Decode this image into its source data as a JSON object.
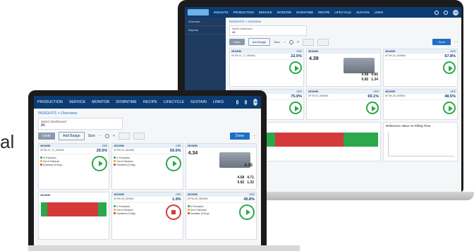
{
  "stray_text": "al",
  "back": {
    "nav": [
      "INSIGHTS",
      "PRODUCTION",
      "SERVICE",
      "MONITOR",
      "DOWNTIME",
      "RECIPE",
      "LIFECYCLE",
      "SUSTAIN",
      "LINKS"
    ],
    "user_initials": "UM",
    "sidebar": [
      "Overview",
      "Reports"
    ],
    "breadcrumb": "INSIGHTS > Overview",
    "dashboard": {
      "label": "Select Dashboard",
      "value": "All"
    },
    "toolbar": {
      "undo": "Undo",
      "add": "Add Badge",
      "size": "Size:",
      "done": "Done"
    },
    "cards": [
      {
        "id": "#E10050",
        "title": "AP76K-57_T1_050MM1",
        "oee_label": "OEE",
        "oee": "22.5%",
        "status": "run"
      },
      {
        "id": "#E10050",
        "value": "4.39",
        "status": "machine",
        "stats": [
          "4.68",
          "4.85",
          "0.82",
          "1.34"
        ]
      },
      {
        "id": "#E10050",
        "title": "AP76K-60_050MM8",
        "oee_label": "OEE",
        "oee": "67.8%",
        "status": "run"
      },
      {
        "id": "#E10050",
        "title": "AP76K-56_050MM1",
        "oee_label": "OEE",
        "oee": "75.9%",
        "status": "run"
      },
      {
        "id": "#E10050",
        "title": "AP76K-57_050MM1",
        "oee_label": "OEE",
        "oee": "69.1%",
        "status": "run"
      },
      {
        "id": "#E10050",
        "title": "AP76K-58_050MM1",
        "oee_label": "OEE",
        "oee": "48.5%",
        "status": "run"
      }
    ],
    "chart_title": "Reference Value As Filling Time"
  },
  "front": {
    "nav": [
      "PRODUCTION",
      "SERVICE",
      "MONITOR",
      "DOWNTIME",
      "RECIPE",
      "LIFECYCLE",
      "SUSTAIN",
      "LINKS"
    ],
    "user_initials": "UM",
    "breadcrumb": "INSIGHTS > Overview",
    "dashboard": {
      "label": "Select Dashboard",
      "value": "All"
    },
    "toolbar": {
      "undo": "Undo",
      "add": "Add Badge",
      "size": "Size:",
      "done": "Done"
    },
    "legend": [
      "In Production",
      "Out of Tolerance",
      "Downtime (S-Stop)"
    ],
    "cards": [
      {
        "id": "#E10050",
        "title": "AP76K-57_T1_050MM1",
        "oee_label": "OEE",
        "oee": "29.5%",
        "status": "run"
      },
      {
        "id": "#E10050",
        "title": "AP76K-60_050MM8",
        "oee_label": "OEE",
        "oee": "59.6%",
        "status": "run"
      },
      {
        "id": "#E10050",
        "value": "4.34",
        "value2": "4.35",
        "status": "machine",
        "stats": [
          "4.68",
          "4.71",
          "0.82",
          "1.32"
        ]
      },
      {
        "id": "#E10050",
        "status": "bar"
      },
      {
        "id": "#E10050",
        "title": "AP76K-58_050MM1",
        "oee_label": "OEE",
        "oee": "1.9%",
        "status": "stop"
      },
      {
        "id": "#E10050",
        "title": "AP76K-60_050MM8",
        "oee_label": "OEE",
        "oee": "45.8%",
        "status": "run"
      }
    ]
  },
  "colors": {
    "nav_bg": "#0b3c73",
    "accent": "#1e6fc5",
    "run": "#2aa84a",
    "stop": "#d43a3a",
    "tolerance": "#f2a31b"
  }
}
